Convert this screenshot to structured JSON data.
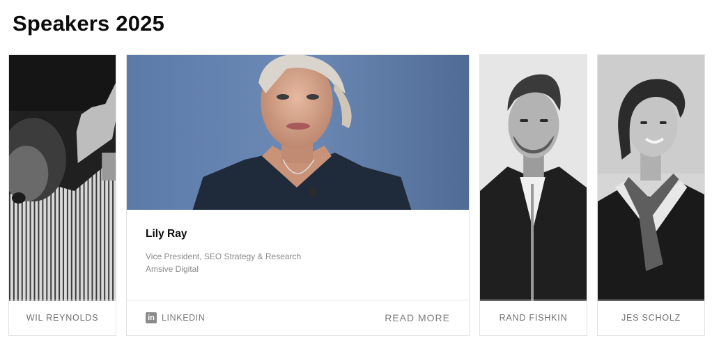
{
  "page": {
    "title": "Speakers 2025"
  },
  "speakers": [
    {
      "name": "WIL REYNOLDS"
    },
    {
      "name": "Lily Ray",
      "role": "Vice President, SEO Strategy & Research",
      "company": "Amsive Digital",
      "linkedin_label": "LINKEDIN",
      "read_more_label": "READ MORE"
    },
    {
      "name": "RAND FISHKIN"
    },
    {
      "name": "JES SCHOLZ"
    }
  ],
  "icons": {
    "linkedin": "linkedin-icon"
  }
}
